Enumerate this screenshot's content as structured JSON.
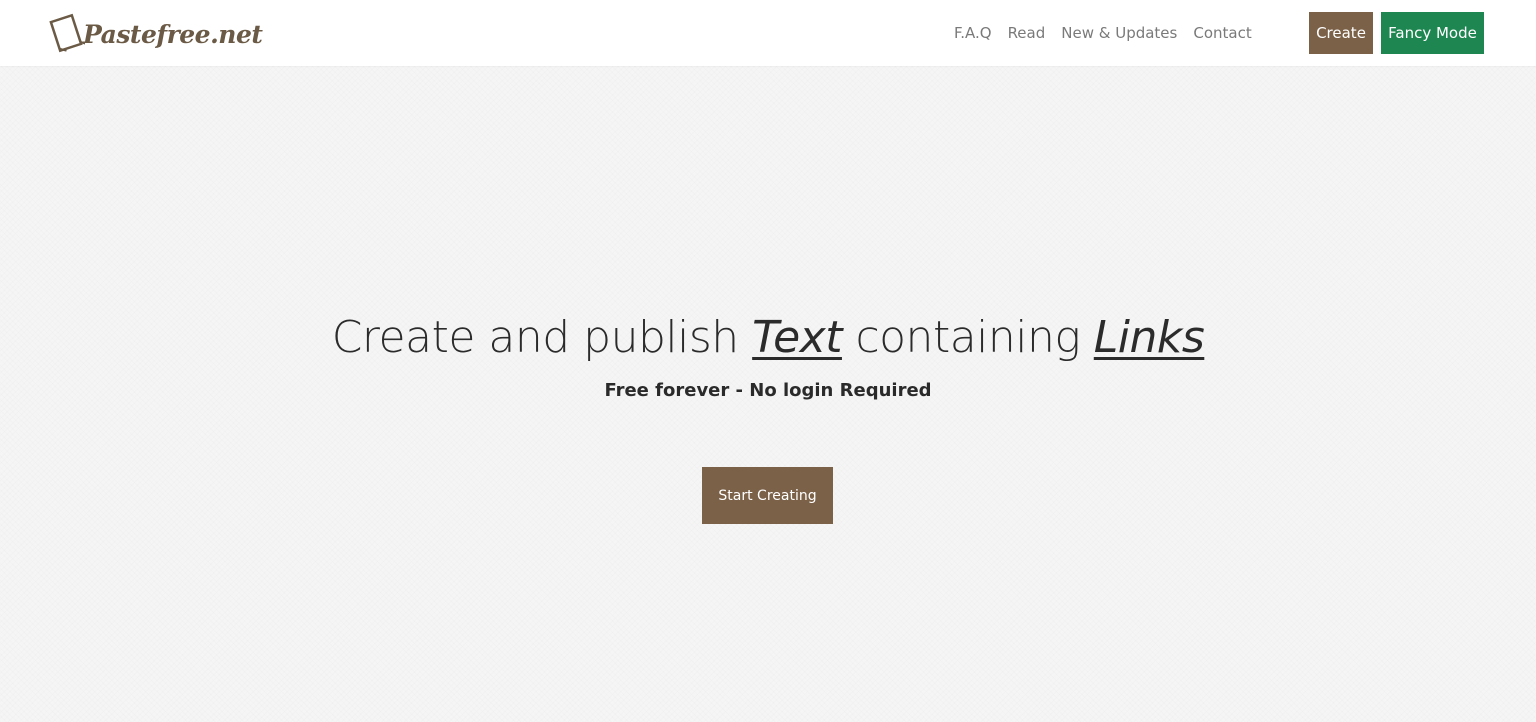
{
  "brand": {
    "name": "Pastefree.net",
    "icon": "paper-sheet-logo-icon"
  },
  "nav": {
    "links": [
      {
        "label": "F.A.Q"
      },
      {
        "label": "Read"
      },
      {
        "label": "New & Updates"
      },
      {
        "label": "Contact"
      }
    ],
    "create_label": "Create",
    "fancy_label": "Fancy Mode"
  },
  "hero": {
    "title_part1": "Create and publish ",
    "title_em1": "Text",
    "title_part2": " containing ",
    "title_em2": "Links",
    "subtitle": "Free forever - No login Required",
    "cta_label": "Start Creating"
  },
  "colors": {
    "brown_accent": "#7b6148",
    "green_accent": "#1e8651",
    "page_bg": "#f5f5f5",
    "nav_bg": "#ffffff",
    "brand_text": "#6b5a45"
  }
}
